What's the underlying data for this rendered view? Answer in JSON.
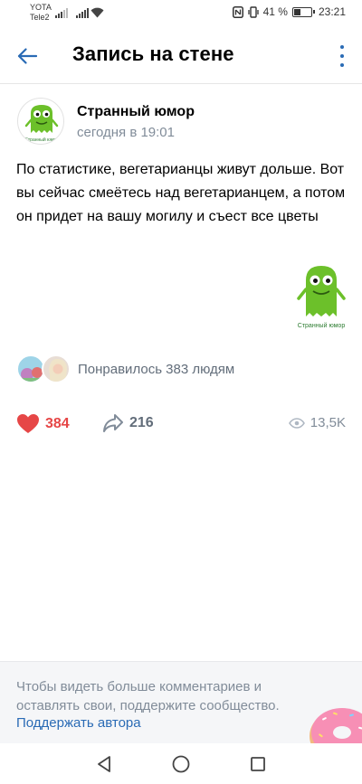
{
  "status_bar": {
    "carrier_1": "YOTA",
    "carrier_2": "Tele2",
    "battery_percent": "41 %",
    "battery_level": 0.41,
    "time": "23:21"
  },
  "header": {
    "title": "Запись на стене"
  },
  "post": {
    "author": "Странный юмор",
    "time": "сегодня в 19:01",
    "text": "По статистике, вегетарианцы живут дольше. Вот вы сейчас смеётесь над вегетарианцем, а потом он придет на вашу могилу и съест все цветы",
    "likes_summary": "Понравилось 383 людям",
    "like_count": "384",
    "share_count": "216",
    "view_count": "13,5K"
  },
  "logo_text": "Странный юмор",
  "support": {
    "text": "Чтобы видеть больше комментариев и оставлять свои, поддержите сообщество.",
    "link": "Поддержать автора"
  },
  "colors": {
    "accent": "#2a6bb5",
    "like": "#e64646",
    "secondary_text": "#818c99",
    "monster_green": "#6cc02a"
  },
  "icons": [
    "back-arrow-icon",
    "more-vertical-icon",
    "heart-icon",
    "share-icon",
    "eye-icon",
    "donut-icon",
    "nav-back-icon",
    "nav-home-icon",
    "nav-recents-icon"
  ]
}
